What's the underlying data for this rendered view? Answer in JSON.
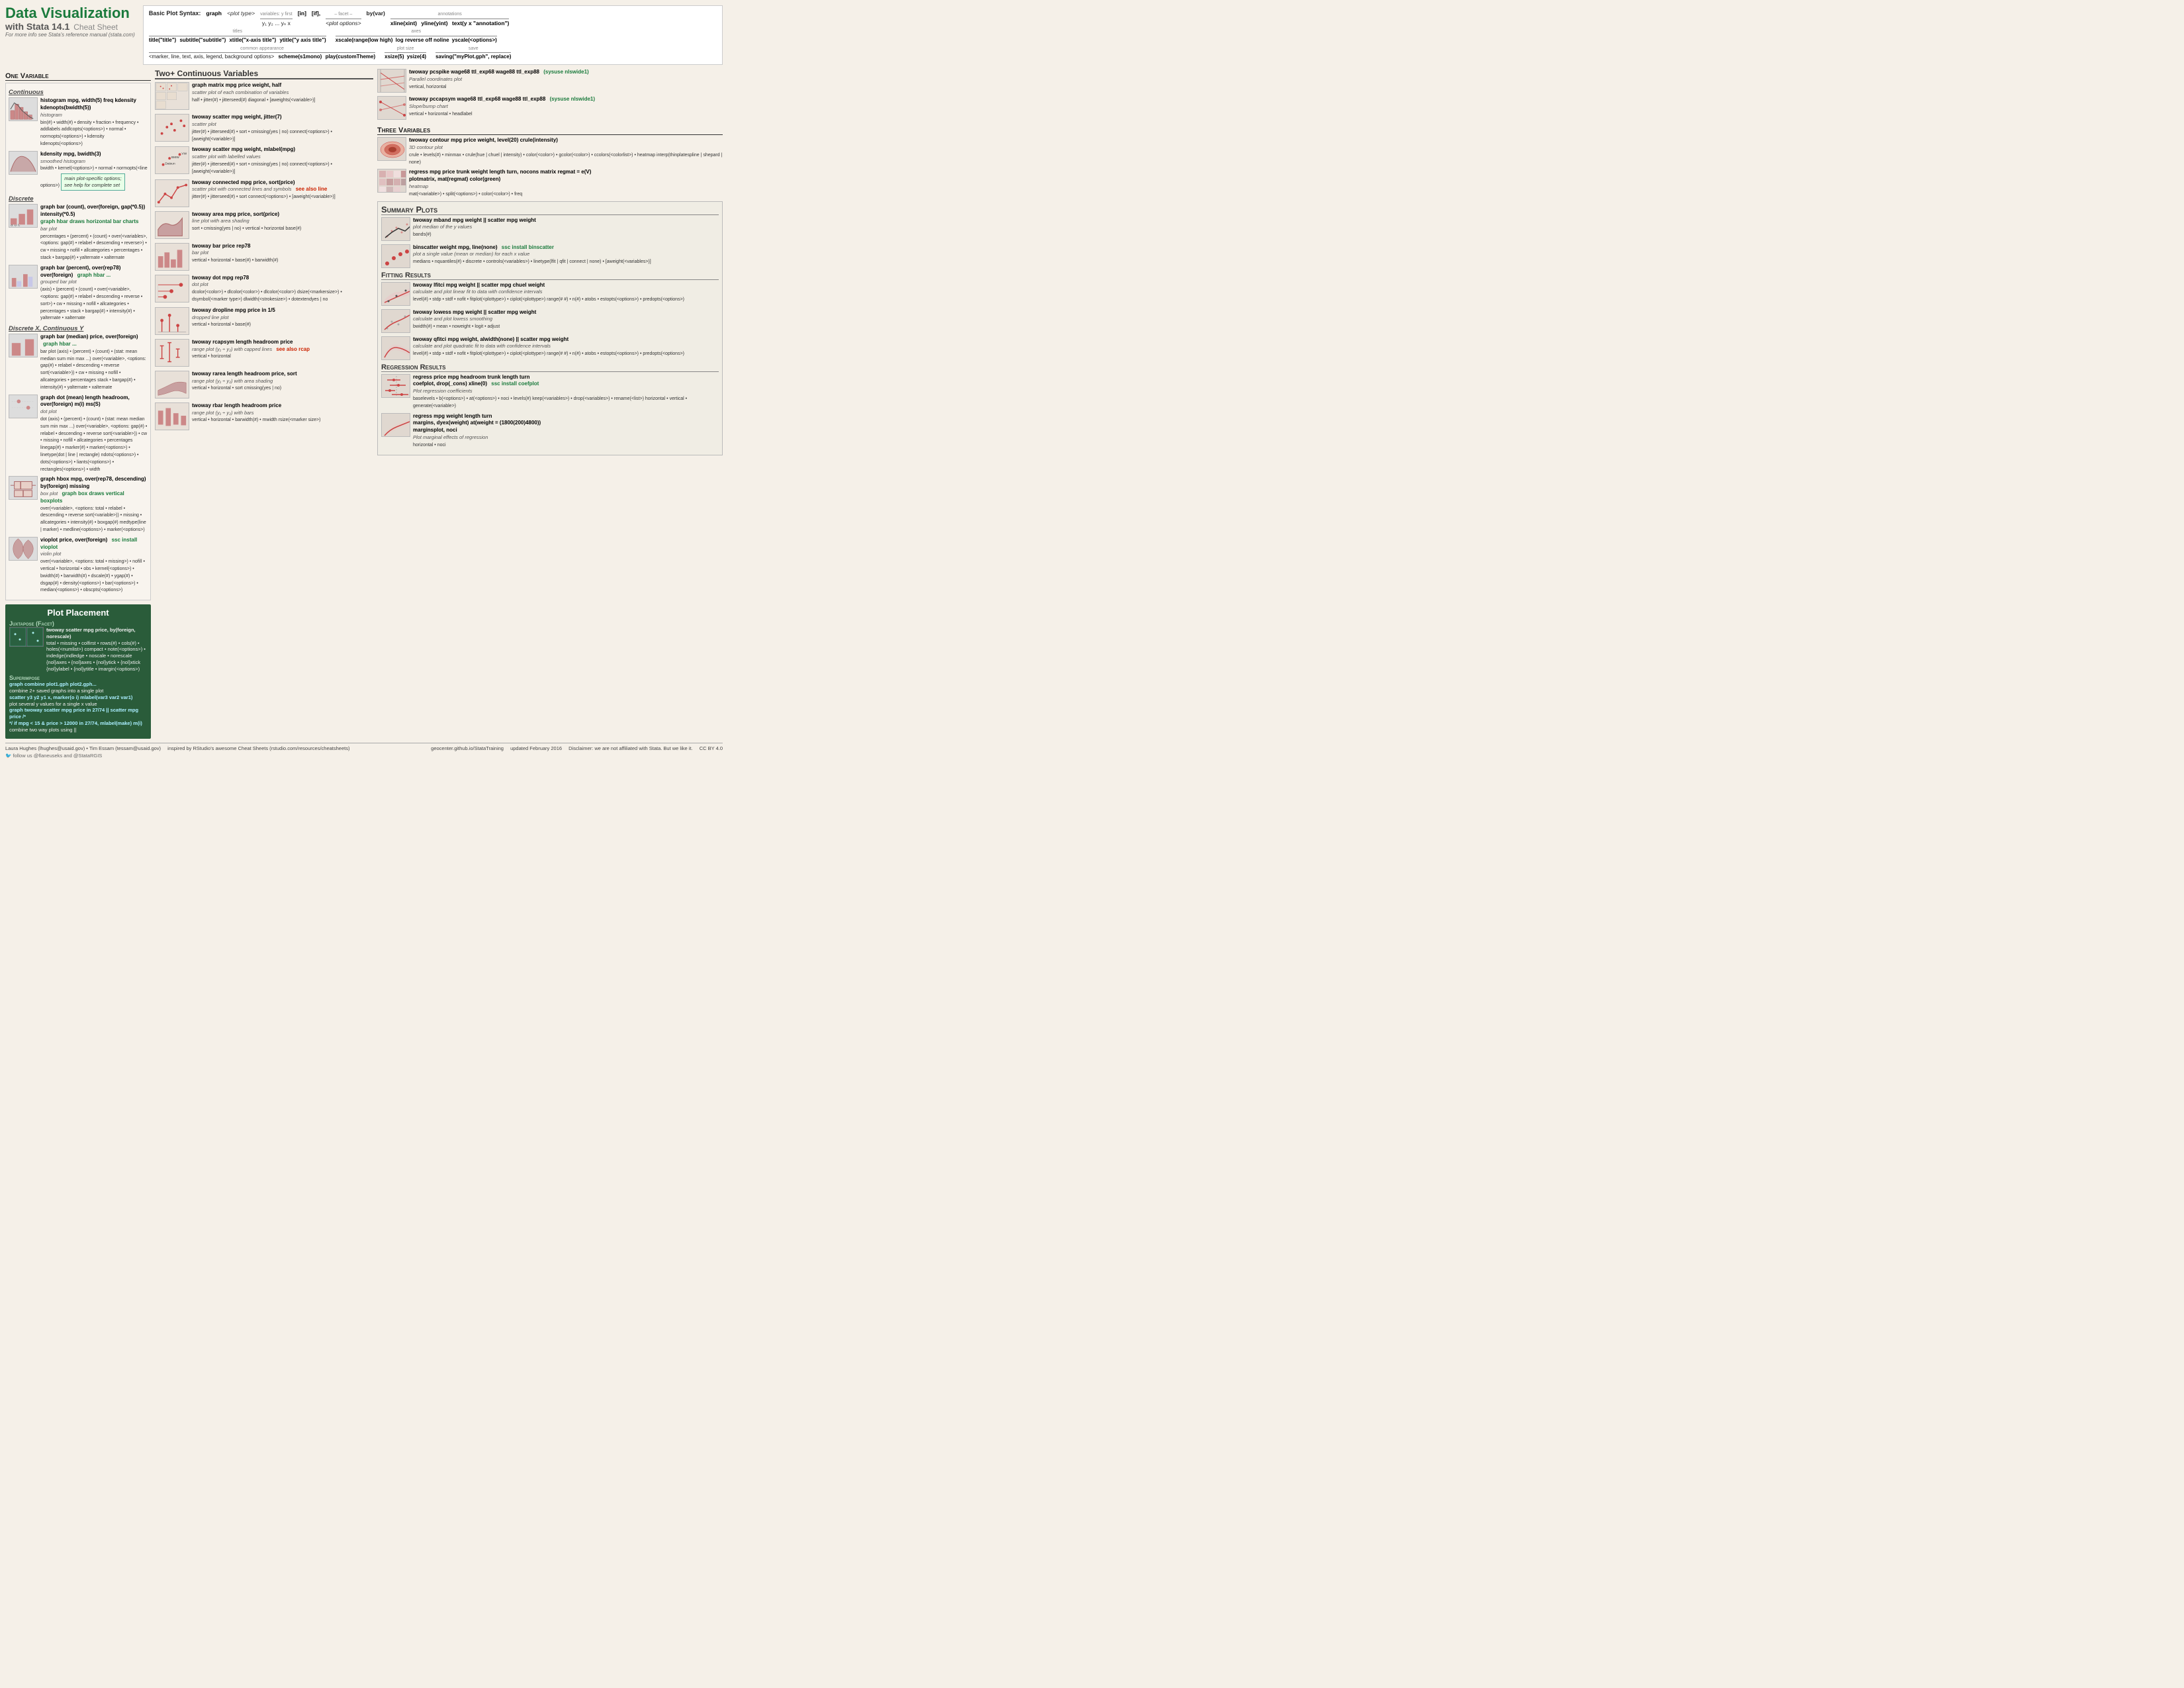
{
  "header": {
    "title_line1": "Data Visualization",
    "title_line2": "with Stata 14.1",
    "title_suffix": "Cheat Sheet",
    "note": "For more info see Stata's reference manual (stata.com)",
    "syntax_title": "Basic Plot Syntax:",
    "syntax_graph": "graph",
    "syntax_plottype": "<plot type>",
    "syntax_vars": "variables: y first",
    "syntax_vars2": "y₁ y₂ ... yₙ x",
    "syntax_in": "[in]",
    "syntax_if": "[if],",
    "syntax_plotopts": "<plot options>",
    "syntax_facet": "– facet –",
    "syntax_by": "by(var)",
    "syntax_xline": "xline(xint)",
    "syntax_yline": "yline(yint)",
    "syntax_annotations": "annotations",
    "syntax_text": "text(y x \"annotation\")",
    "syntax_titles": "titles",
    "syntax_title_cmd": "title(\"title\")",
    "syntax_subtitle": "subtitle(\"subtitle\")",
    "syntax_xtitle": "xtitle(\"x-axis title\")",
    "syntax_ytitle": "ytitle(\"y axis title\")",
    "syntax_axes": "axes",
    "syntax_xscale": "xscale(range(low high)",
    "syntax_log": "log reverse off noline",
    "syntax_yscale": "yscale(<options>)",
    "syntax_appearance": "common appearance",
    "syntax_marker": "<marker, line, text, axis, legend, background options>",
    "syntax_scheme": "scheme(s1mono)",
    "syntax_play": "play(customTheme)",
    "syntax_plotsize": "plot size",
    "syntax_xsize": "xsize(5)",
    "syntax_ysize": "ysize(4)",
    "syntax_save": "save",
    "syntax_saving": "saving(\"myPlot.gph\", replace)"
  },
  "one_var": {
    "title": "One Variable",
    "continuous_header": "Continuous",
    "hist_cmd": "histogram mpg, width(5) freq kdensity kdenopts(bwidth(5))",
    "hist_sub": "histogram",
    "hist_opts": "bin(#) • width(#) • density • fraction • frequency • addlabels addlcopts(<options>) • normal • normopts(<options>) • kdensity kdenopts(<options>)",
    "kdensity_cmd": "kdensity mpg, bwidth(3)",
    "kdensity_sub": "smoothed histogram",
    "kdensity_opts": "bwidth • kernel(<options>) • normal • normopts(<line options>)",
    "discrete_header": "Discrete",
    "graphbar_cmd": "graph bar (count), over(foreign, gap(*0.5)) intensity(*0.5)",
    "graphbar_sub": "bar plot",
    "graphbar_green": "graph hbar draws horizontal bar charts",
    "graphbar_opts": "percentages • (percent) • (count) • over(<variables>, <options: gap(#) • relabel • descending • reverse>) • cw • missing • nofill • allcategories • percentages • stack • bargap(#) • yalternate • xalternate",
    "graphbar2_cmd": "graph bar (percent), over(rep78) over(foreign)",
    "graphbar2_green": "graph hbar ...",
    "graphbar2_sub": "grouped bar plot",
    "graphbar2_opts": "(axis) • (percent) • (count) • over(<variable>, <options: gap(#) • relabel • descending • reverse • sort>) • cw • missing • nofill • allcategories • percentages • stack • bargap(#) • intensity(#) • yalternate • xalternate",
    "disc_cont_header": "Discrete X, Continuous Y",
    "graphbar_mean_cmd": "graph bar (median) price, over(foreign)",
    "graphbar_mean_green": "graph hbar ...",
    "graphbar_mean_opts": "bar plot (axis) • (percent) • (count) • (stat: mean median sum min max ...) over(<variable>, <options: gap(#) • relabel • descending • reverse sort(<variable>)) • cw • missing • nofill • allcategories • percentages stack • bargap(#) • intensity(#) • yalternate • xalternate",
    "graphdot_cmd": "graph dot (mean) length headroom, over(foreign) m(i) ms(S)",
    "graphdot_sub": "dot plot",
    "graphdot_opts": "dot (axis) • (percent) • (count) • (stat: mean median sum min max ...) over(<variable>, <options: gap(#) • relabel • descending • reverse sort(<variable>)) • cw • missing • nofill • allcategories • percentages linegap(#) • marker(#) • marker(<options>) • linetype(dot | line | rectangle) ndots(<options>) • dots(<options>) • liants(<options>) • rectangles(<options>) • width",
    "graphhbox_cmd": "graph hbox mpg, over(rep78, descending) by(foreign) missing",
    "graphhbox_sub": "box plot",
    "graphhbox_green": "graph box draws vertical boxplots",
    "graphhbox_opts": "over(<variable>, <options: total • relabel • descending • reverse sort(<variable>)) • missing • allcategories • intensity(#) • boxgap(#) medtype(line | marker) • medline(<options>) • marker(<options>)",
    "vioplot_cmd": "vioplot price, over(foreign)",
    "vioplot_sub": "violin plot",
    "vioplot_ssc": "ssc install vioplot",
    "vioplot_opts": "over(<variable>, <options: total • missing>) • nofill • vertical • horizontal • obs • kernel(<options>) • bwidth(#) • barwidth(#) • dscale(#) • ygap(#) • dsgap(#) • density(<options>) • bar(<options>) • median(<options>) • obscpts(<options>)"
  },
  "two_plus": {
    "title": "Two+ Continuous Variables",
    "graphmatrix_cmd": "graph matrix mpg price weight, half",
    "graphmatrix_desc": "scatter plot of each combination of variables",
    "graphmatrix_opts": "half • jitter(#) • jitterseed(#) diagonal • [aweights(<variable>)]",
    "twoscatter_cmd": "twoway scatter mpg weight, jitter(7)",
    "twoscatter_desc": "scatter plot",
    "twoscatter_opts": "jitter(#) • jitterseed(#) • sort • cmissing(yes | no) connect(<options>) • [aweight(<variable>)]",
    "twoscatter_mlabel_cmd": "twoway scatter mpg weight, mlabel(mpg)",
    "twoscatter_mlabel_desc": "scatter plot with labelled values",
    "twoscatter_mlabel_opts": "jitter(#) • jitterseed(#) • sort • cmissing(yes | no) connect(<options>) • [aweight(<variable>)]",
    "twoconnected_cmd": "twoway connected mpg price, sort(price)",
    "twoconnected_desc": "scatter plot with connected lines and symbols",
    "twoconnected_see": "see also line",
    "twoconnected_opts": "jitter(#) • jitterseed(#) • sort connect(<options>) • [aweight(<variable>)]",
    "twoarea_cmd": "twoway area mpg price, sort(price)",
    "twoarea_desc": "line plot with area shading",
    "twoarea_opts": "sort • cmissing(yes | no) • vertical • horizontal base(#)",
    "twobar_cmd": "twoway bar price rep78",
    "twobar_desc": "bar plot",
    "twobar_opts": "vertical • horizontal • base(#) • barwidth(#)",
    "twodot_cmd": "twoway dot mpg rep78",
    "twodot_desc": "dot plot",
    "twodot_opts": "dcolor(<color>) • dlcolor(<color>) • dlcolor(<color>) dsize(<markersize>) • dsymbol(<marker type>) dlwidth(<strokesize>) • dotextendyes | no",
    "twodropline_cmd": "twoway dropline mpg price in 1/5",
    "twodropline_desc": "dropped line plot",
    "twodropline_opts": "vertical • horizontal • base(#)",
    "tworcapsym_cmd": "twoway rcapsym length headroom price",
    "tworcapsym_desc": "range plot (y₁ ÷ y₂) with capped lines",
    "tworcapsym_see": "see also rcap",
    "tworcapsym_opts": "vertical • horizontal",
    "tworarea_cmd": "twoway rarea length headroom price, sort",
    "tworarea_desc": "range plot (y₁ ÷ y₂) with area shading",
    "tworarea_opts": "vertical • horizontal • sort cmissing(yes | no)",
    "tworbar_cmd": "twoway rbar length headroom price",
    "tworbar_desc": "range plot (y₁ ÷ y₂) with bars",
    "tworbar_opts": "vertical • horizontal • barwidth(#) • mwidth rsize(<marker size>)"
  },
  "three_var": {
    "title": "Three Variables",
    "contour_cmd": "twoway contour mpg price weight, level(20) crule(intensity)",
    "contour_desc": "3D contour plot",
    "contour_opts": "crule • levels(#) • minmax • crule(hue | chuel | intensity) • color(<color>) • gcolor(<color>) • ccolors(<colorlist>) • heatmap interp(thinplatespline | shepard | none)",
    "plotmatrix_cmd": "regress mpg price trunk weight length turn, nocons matrix regmat = e(V)",
    "plotmatrix_cmd2": "plotmatrix, mat(regmat) color(green)",
    "plotmatrix_desc": "heatmap",
    "plotmatrix_opts": "mat(<variable>) • split(<options>) • color(<color>) • freq"
  },
  "summary_plots": {
    "title": "Summary Plots",
    "mband_cmd": "twoway mband mpg weight || scatter mpg weight",
    "mband_desc": "plot median of the y values",
    "mband_opts": "bands(#)",
    "binscatter_cmd": "binscatter weight mpg, line(none)",
    "binscatter_ssc": "ssc install binscatter",
    "binscatter_desc": "plot a single value (mean or median) for each x value",
    "binscatter_opts": "medians • nquantiles(#) • discrete • controls(<variables>) • linetype(lfit | qfit | connect | none) • [aweight(<variables>)]",
    "fitting_title": "Fitting Results",
    "lfitci_cmd": "twoway lfitci mpg weight || scatter mpg chuel weight",
    "lfitci_desc": "calculate and plot linear fit to data with confidence intervals",
    "lfitci_opts": "level(#) • stdp • stdf • nofit • fitplot(<plottype>) • ciplot(<plottype>) range(# #) • n(#) • atobs • estopts(<options>) • predopts(<options>)",
    "lowess_cmd": "twoway lowess mpg weight || scatter mpg weight",
    "lowess_desc": "calculate and plot lowess smoothing",
    "lowess_opts": "bwidth(#) • mean • noweight • logit • adjust",
    "qfitci_cmd": "twoway qfitci mpg weight, alwidth(none) || scatter mpg weight",
    "qfitci_desc": "calculate and plot quadratic fit to data with confidence intervals",
    "qfitci_opts": "level(#) • stdp • stdf • nofit • fitplot(<plottype>) • ciplot(<plottype>) range(# #) • n(#) • atobs • estopts(<options>) • predopts(<options>)",
    "regression_title": "Regression Results",
    "coefplot_cmd": "regress price mpg headroom trunk length turn",
    "coefplot_cmd2": "coefplot, drop(_cons) xline(0)",
    "coefplot_ssc": "ssc install coefplot",
    "coefplot_desc": "Plot regression coefficients",
    "coefplot_opts": "baselevels • b(<options>) • at(<options>) • noci • levels(#) keep(<variables>) • drop(<variables>) • rename(<list>) horizontal • vertical • generate(<variable>)",
    "margins_cmd": "regress mpg weight length turn",
    "margins_cmd2": "margins, dyex(weight) at(weight = (1800(200)4800))",
    "marginsplot_cmd": "marginsplot, noci",
    "marginsplot_desc": "Plot marginal effects of regression",
    "marginsplot_opts": "horizontal • noci"
  },
  "plot_placement": {
    "title": "Plot Placement",
    "juxtapose_header": "Juxtapose (Facet)",
    "twoscatter_pp_cmd": "twoway scatter mpg price, by(foreign, norescale)",
    "twoscatter_pp_opts": "total • missing • colfirst • rows(#) • cols(#) • holes(<numlist>) compact • note(<options>) • indedge(indledge • noscale • norescale {nol}axes • {nol}axes • {nol}ytick • {nol}xtick {nol}ylabel • {nol}ytitle • imargin(<options>)",
    "superimpose_header": "Superimpose",
    "combine_cmd": "graph combine plot1.gph plot2.gph...",
    "combine_desc": "combine 2+ saved graphs into a single plot",
    "scatter_cmd": "scatter y3 y2 y1 x, marker(o i) mlabel(var3 var2 var1)",
    "scatter_desc": "plot several y values for a single x value",
    "twoway_cmd": "graph twoway scatter mpg price in 27/74 || scatter mpg price /*",
    "twoway_cmd2": "*/ if mpg < 15  & price > 12000 in 27/74, mlabel(make) m(i)",
    "twoway_desc": "combine two way plots using ||"
  },
  "parallel": {
    "pcspike_cmd": "twoway pcspike wage68 ttl_exp68 wage88 ttl_exp88",
    "pcspike_desc": "Parallel coordinates plot",
    "pcspike_ssc": "(sysuse nlswide1)",
    "pcspike_opts": "vertical, horizontal",
    "pccapsym_cmd": "twoway pccapsym wage68 ttl_exp68 wage88 ttl_exp88",
    "pccapsym_desc": "Slope/bump chart",
    "pccapsym_ssc": "(sysuse nlswide1)",
    "pccapsym_opts": "vertical • horizontal • headlabel"
  },
  "footer": {
    "author1": "Laura Hughes (lhughes@usaid.gov)",
    "author2": "Tim Essam (tessam@usaid.gov)",
    "inspired": "inspired by RStudio's awesome Cheat Sheets (rstudio.com/resources/cheatsheets)",
    "github": "geocenter.github.io/StataTraining",
    "updated": "updated February 2016",
    "disclaimer": "Disclaimer: we are not affiliated with Stata. But we like it.",
    "twitter": "follow us @flaneuseks and @StataRGIS",
    "license": "CC BY 4.0"
  }
}
